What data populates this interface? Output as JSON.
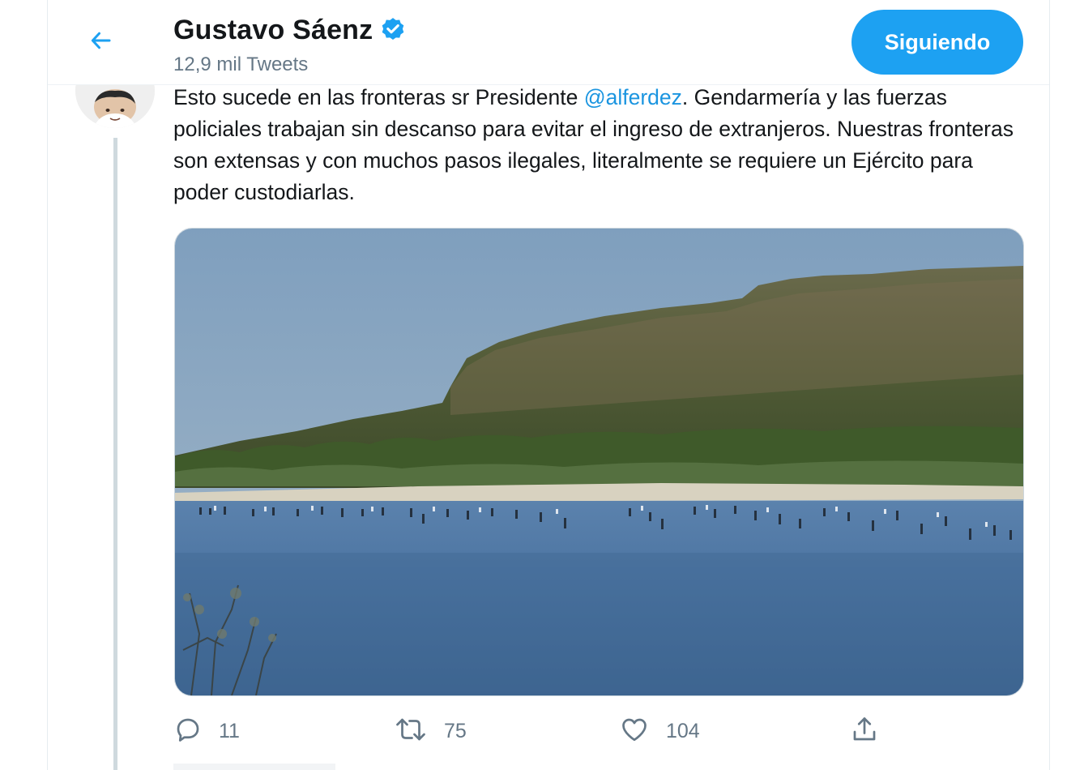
{
  "header": {
    "display_name": "Gustavo Sáenz",
    "tweet_count": "12,9 mil Tweets",
    "follow_label": "Siguiendo"
  },
  "tweet": {
    "text_before_mention": "Esto sucede en las fronteras sr Presidente ",
    "mention": "@alferdez",
    "text_after_mention": ". Gendarmería y las fuerzas policiales trabajan sin descanso para evitar el ingreso de extranjeros. Nuestras fronteras son extensas y con muchos pasos ilegales, literalmente se requiere un Ejército para poder custodiarlas.",
    "replies": "11",
    "retweets": "75",
    "likes": "104"
  },
  "icons": {
    "back": "arrow-left-icon",
    "verified": "verified-badge-icon",
    "reply": "reply-icon",
    "retweet": "retweet-icon",
    "like": "heart-icon",
    "share": "share-icon"
  },
  "colors": {
    "accent": "#1da1f2",
    "link": "#1b95e0",
    "text_primary": "#14171a",
    "text_secondary": "#657786"
  }
}
